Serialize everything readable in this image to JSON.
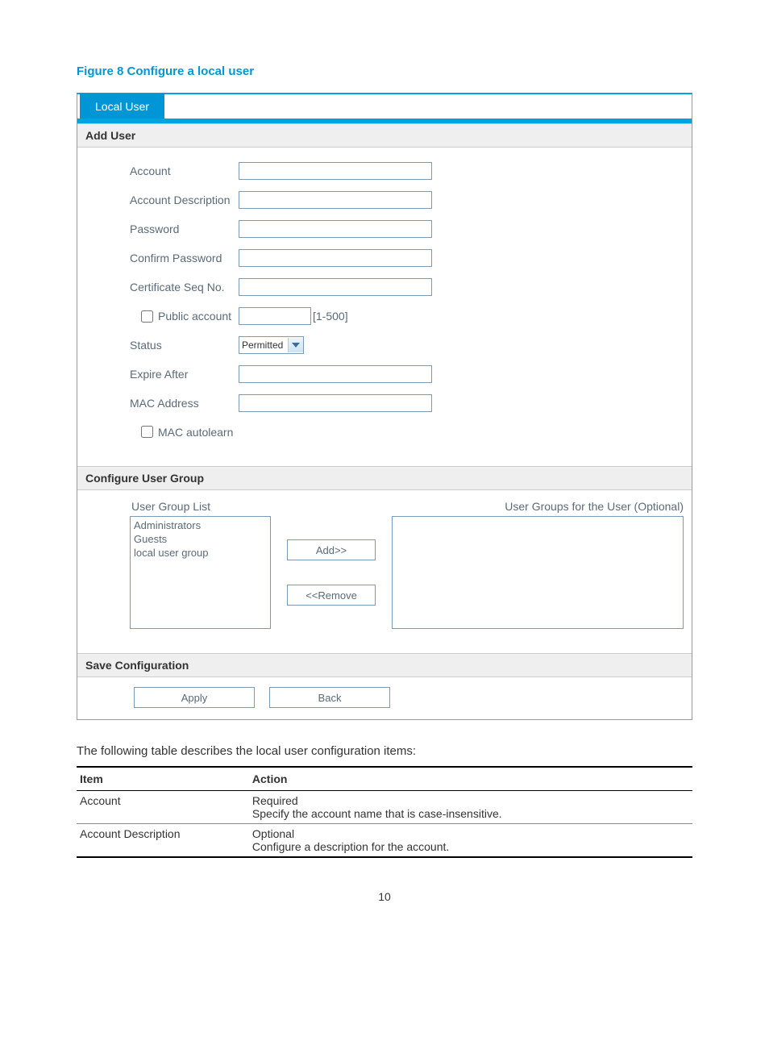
{
  "figure_caption": "Figure 8 Configure a local user",
  "tab_label": "Local User",
  "sections": {
    "add_user_title": "Add User",
    "configure_group_title": "Configure User Group",
    "save_config_title": "Save Configuration"
  },
  "form": {
    "account_label": "Account",
    "account_value": "",
    "account_desc_label": "Account Description",
    "account_desc_value": "",
    "password_label": "Password",
    "password_value": "",
    "confirm_password_label": "Confirm Password",
    "confirm_password_value": "",
    "cert_seq_label": "Certificate Seq No.",
    "cert_seq_value": "",
    "public_account_label": "Public account",
    "public_account_range_value": "",
    "public_account_range_text": "[1-500]",
    "status_label": "Status",
    "status_value": "Permitted",
    "expire_label": "Expire After",
    "expire_value": "",
    "mac_label": "MAC Address",
    "mac_value": "",
    "mac_autolearn_label": "MAC autolearn"
  },
  "groups": {
    "left_label": "User Group List",
    "right_label": "User Groups for the User (Optional)",
    "left_items": [
      "Administrators",
      "Guests",
      "local user group"
    ],
    "right_items": [],
    "add_btn": "Add>>",
    "remove_btn": "<<Remove"
  },
  "actions": {
    "apply": "Apply",
    "back": "Back"
  },
  "below_text": "The following table describes the local user configuration items:",
  "table": {
    "headers": {
      "item": "Item",
      "action": "Action"
    },
    "rows": [
      {
        "item": "Account",
        "action_line1": "Required",
        "action_line2": "Specify the account name that is case-insensitive."
      },
      {
        "item": "Account Description",
        "action_line1": "Optional",
        "action_line2": "Configure a description for the account."
      }
    ]
  },
  "page_number": "10"
}
